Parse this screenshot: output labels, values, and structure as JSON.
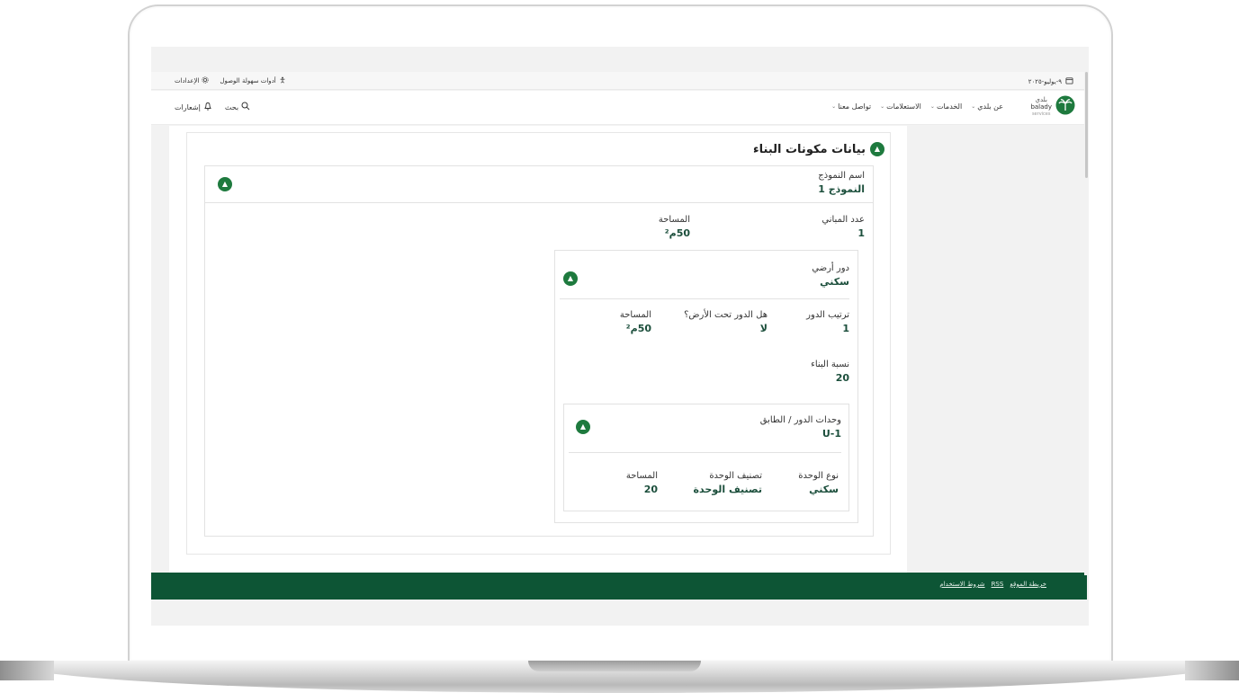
{
  "topbar": {
    "date": "٩-يوليو-٢٠٢٥",
    "accessibility_label": "أدوات سهولة الوصول",
    "settings_label": "الإعدادات"
  },
  "nav": {
    "logo_ar": "بلدي",
    "logo_en": "balady",
    "logo_sub": "services",
    "items": [
      {
        "label": "عن بلدي"
      },
      {
        "label": "الخدمات"
      },
      {
        "label": "الاستعلامات"
      },
      {
        "label": "تواصل معنا"
      }
    ],
    "search_label": "بحث",
    "notifications_label": "إشعارات"
  },
  "section": {
    "title": "بيانات مكونات البناء",
    "model": {
      "name_label": "اسم النموذج",
      "name_value": "النموذج 1",
      "buildings_label": "عدد المباني",
      "buildings_value": "1",
      "area_label": "المساحة",
      "area_value": "50م²"
    },
    "floor": {
      "type_label": "دور أرضي",
      "type_value": "سكني",
      "order_label": "ترتيب الدور",
      "order_value": "1",
      "underground_label": "هل الدور تحت الأرض؟",
      "underground_value": "لا",
      "area_label": "المساحة",
      "area_value": "50م²",
      "ratio_label": "نسبة البناء",
      "ratio_value": "20"
    },
    "unit": {
      "units_label": "وحدات الدور / الطابق",
      "units_value": "U-1",
      "type_label": "نوع الوحدة",
      "type_value": "سكني",
      "class_label": "تصنيف الوحدة",
      "class_value": "تصنيف الوحدة",
      "area_label": "المساحة",
      "area_value": "20"
    }
  },
  "footer": {
    "links": [
      "خريطة الموقع",
      "RSS",
      "شروط الاستخدام"
    ]
  },
  "colors": {
    "brand_green": "#1e7a3e",
    "value_text": "#1c4f3c",
    "footer_bg": "#0d5535"
  }
}
